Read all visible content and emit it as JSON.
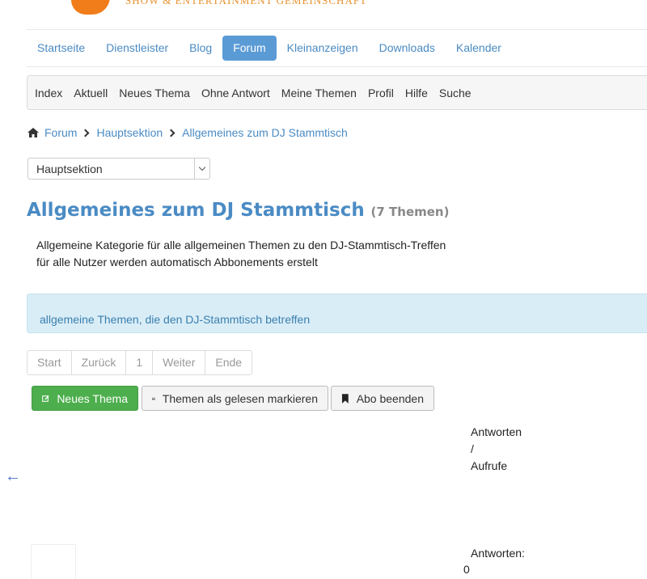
{
  "logo": {
    "text": "SHOW & ENTERTAINMENT GEMEINSCHAFT"
  },
  "mainnav": {
    "items": [
      "Startseite",
      "Dienstleister",
      "Blog",
      "Forum",
      "Kleinanzeigen",
      "Downloads",
      "Kalender"
    ],
    "active": "Forum"
  },
  "subnav": {
    "items": [
      "Index",
      "Aktuell",
      "Neues Thema",
      "Ohne Antwort",
      "Meine Themen",
      "Profil",
      "Hilfe",
      "Suche"
    ]
  },
  "breadcrumb": [
    "Forum",
    "Hauptsektion",
    "Allgemeines zum DJ Stammtisch"
  ],
  "section_select": {
    "value": "Hauptsektion"
  },
  "title": {
    "main": "Allgemeines zum DJ Stammtisch",
    "count": "(7 Themen)"
  },
  "description": {
    "line1": "Allgemeine Kategorie für alle allgemeinen Themen zu den DJ-Stammtisch-Treffen",
    "line2": "für alle Nutzer werden automatisch Abbonements erstelt"
  },
  "infobox": {
    "text": "allgemeine Themen, die den DJ-Stammtisch betreffen"
  },
  "pagination": [
    "Start",
    "Zurück",
    "1",
    "Weiter",
    "Ende"
  ],
  "buttons": {
    "new_topic": "Neues Thema",
    "mark_read": "Themen als gelesen markieren",
    "unsubscribe": "Abo beenden"
  },
  "table_header": {
    "line1": "Antworten",
    "line2": "/",
    "line3": "Aufrufe"
  },
  "back_arrow": "←",
  "row": {
    "label": "Antworten:",
    "value": "0"
  },
  "colors": {
    "accent": "#4a8bc4",
    "active_nav": "#5b9bd5",
    "green": "#4cae4c",
    "info_bg": "#d9edf7"
  }
}
